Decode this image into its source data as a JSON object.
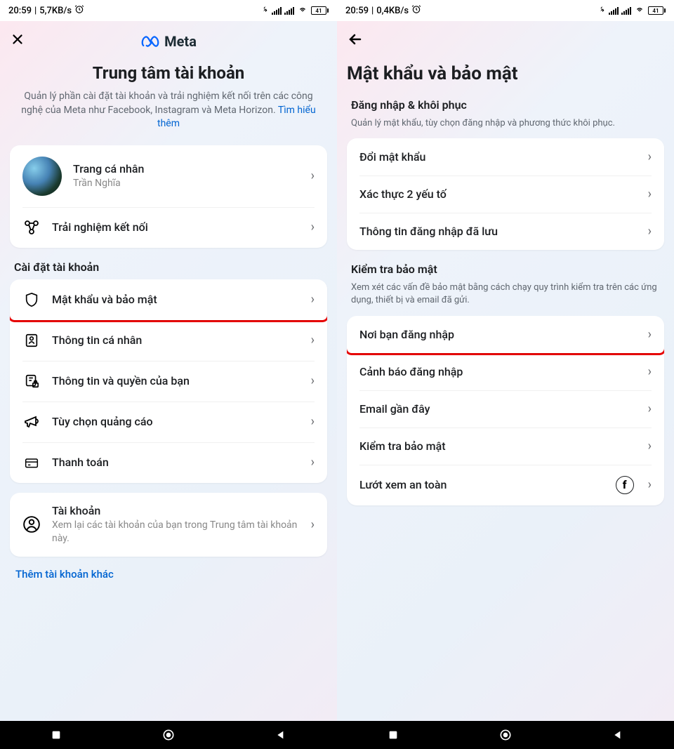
{
  "status": {
    "left": {
      "time": "20:59",
      "net_speed": "5,7KB/s"
    },
    "right": {
      "time": "20:59",
      "net_speed": "0,4KB/s"
    },
    "battery": "41"
  },
  "left": {
    "logo": "Meta",
    "title": "Trung tâm tài khoản",
    "subtitle_prefix": "Quản lý phần cài đặt tài khoản và trải nghiệm kết nối trên các công nghệ của Meta như Facebook, Instagram và Meta Horizon. ",
    "subtitle_link": "Tìm hiểu thêm",
    "profile": {
      "title": "Trang cá nhân",
      "name": "Trần Nghĩa"
    },
    "connected": "Trải nghiệm kết nối",
    "section": "Cài đặt tài khoản",
    "items": {
      "password": "Mật khẩu và bảo mật",
      "personal": "Thông tin cá nhân",
      "info_rights": "Thông tin và quyền của bạn",
      "ad_prefs": "Tùy chọn quảng cáo",
      "payment": "Thanh toán"
    },
    "accounts": {
      "title": "Tài khoản",
      "sub": "Xem lại các tài khoản của bạn trong Trung tâm tài khoản này."
    },
    "add_account": "Thêm tài khoản khác"
  },
  "right": {
    "title": "Mật khẩu và bảo mật",
    "section1": {
      "label": "Đăng nhập & khôi phục",
      "sub": "Quản lý mật khẩu, tùy chọn đăng nhập và phương thức khôi phục."
    },
    "items1": {
      "change_pw": "Đổi mật khẩu",
      "two_factor": "Xác thực 2 yếu tố",
      "saved_login": "Thông tin đăng nhập đã lưu"
    },
    "section2": {
      "label": "Kiểm tra bảo mật",
      "sub": "Xem xét các vấn đề bảo mật bằng cách chạy quy trình kiểm tra trên các ứng dụng, thiết bị và email đã gửi."
    },
    "items2": {
      "where_logged": "Nơi bạn đăng nhập",
      "login_alerts": "Cảnh báo đăng nhập",
      "recent_emails": "Email gần đây",
      "security_check": "Kiểm tra bảo mật",
      "safe_browsing": "Lướt xem an toàn"
    }
  }
}
